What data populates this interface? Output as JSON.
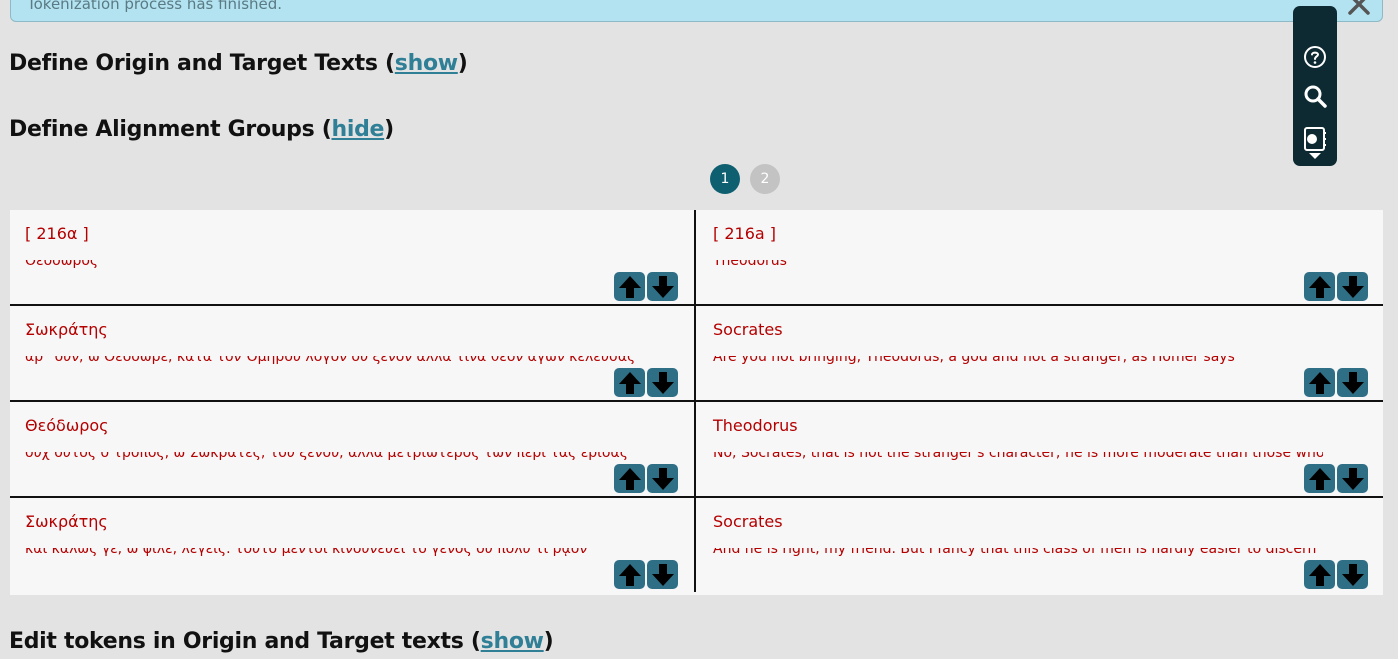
{
  "banner": {
    "message": "Tokenization process has finished.",
    "close_icon": "close-icon"
  },
  "sections": {
    "origin_target": {
      "title": "Define Origin and Target Texts (",
      "toggle": "show",
      "close": ")"
    },
    "alignment_groups": {
      "title": "Define Alignment Groups (",
      "toggle": "hide",
      "close": ")"
    },
    "edit_tokens": {
      "title": "Edit tokens in Origin and Target texts (",
      "toggle": "show",
      "close": ")"
    }
  },
  "pagination": {
    "pages": [
      "1",
      "2"
    ],
    "active": "1"
  },
  "alignment_rows": [
    {
      "left_speaker": "[  216α  ]",
      "left_snippet": "Θεόδωρος",
      "right_speaker": "[  216a  ]",
      "right_snippet": "Theodorus"
    },
    {
      "left_speaker": "Σωκράτης",
      "left_snippet": "ἆρ᾽ οὖν, ὦ Θεόδωρε, κατὰ τὸν Ὁμήρου λόγον οὐ ξένον ἀλλά τινα θεὸν ἄγων κέλευσας",
      "right_speaker": "Socrates",
      "right_snippet": "Are you not bringing, Theodorus, a god and not a stranger, as Homer says"
    },
    {
      "left_speaker": "Θεόδωρος",
      "left_snippet": "οὐχ οὗτος ὁ τρόπος, ὦ Σώκρατες, τοῦ ξένου, ἀλλὰ μετριώτερος τῶν περὶ τὰς ἔριδας",
      "right_speaker": "Theodorus",
      "right_snippet": "No, Socrates, that is not the stranger's character; he is more moderate than those who devote"
    },
    {
      "left_speaker": "Σωκράτης",
      "left_snippet": "καὶ καλῶς γε, ὦ φίλε, λέγεις. τοῦτο μέντοι κινδυνεύει τὸ γένος οὐ πολύ τι ῥᾷον",
      "right_speaker": "Socrates",
      "right_snippet": "And he is right, my friend. But I fancy that this class of men is hardly easier to discern"
    }
  ],
  "arrow_icons": {
    "up": "arrow-up-icon",
    "down": "arrow-down-icon"
  },
  "toolbar": {
    "help": "help-circle-icon",
    "search": "search-icon",
    "notebook": "notebook-icon",
    "expand": "chevron-down-icon"
  },
  "colors": {
    "background": "#e3e3e3",
    "link": "#2f7f96",
    "speaker_text": "#b40000",
    "arrow_button": "#2f6f85",
    "page_active": "#0e5f70",
    "toolbar_bg": "#0d2a33"
  }
}
